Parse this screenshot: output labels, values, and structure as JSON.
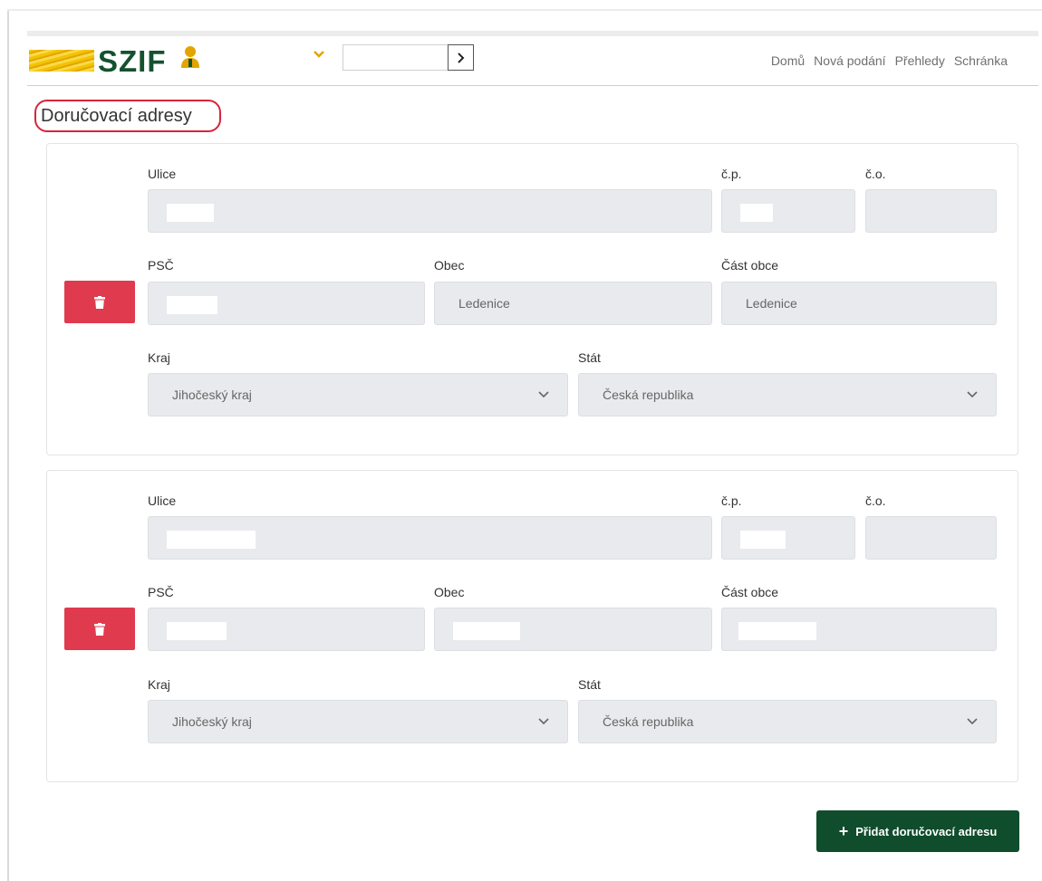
{
  "brand": {
    "name": "SZIF"
  },
  "search": {
    "value": ""
  },
  "nav": {
    "items": [
      "Domů",
      "Nová podání",
      "Přehledy",
      "Schránka"
    ]
  },
  "page": {
    "title": "Doručovací adresy"
  },
  "labels": {
    "street": "Ulice",
    "cp": "č.p.",
    "co": "č.o.",
    "psc": "PSČ",
    "obec": "Obec",
    "cast_obce": "Část obce",
    "kraj": "Kraj",
    "stat": "Stát"
  },
  "addresses": [
    {
      "street": "",
      "cp": "",
      "co": "",
      "psc": "",
      "obec": "Ledenice",
      "cast_obce": "Ledenice",
      "kraj": "Jihočeský kraj",
      "stat": "Česká republika"
    },
    {
      "street": "",
      "cp": "",
      "co": "",
      "psc": "",
      "obec": "",
      "cast_obce": "",
      "kraj": "Jihočeský kraj",
      "stat": "Česká republika"
    }
  ],
  "actions": {
    "add_address": "Přidat doručovací adresu"
  },
  "icons": {
    "logo": "szif-logo",
    "user": "user-icon",
    "chevron": "chevron-down-icon",
    "go": "chevron-right-icon",
    "delete": "trash-icon",
    "add": "plus-icon"
  },
  "colors": {
    "brand_green": "#0f4d2c",
    "brand_yellow": "#e4a400",
    "delete_red": "#e03a4e",
    "highlight": "#d7243c",
    "field_bg": "#e8eaed"
  }
}
